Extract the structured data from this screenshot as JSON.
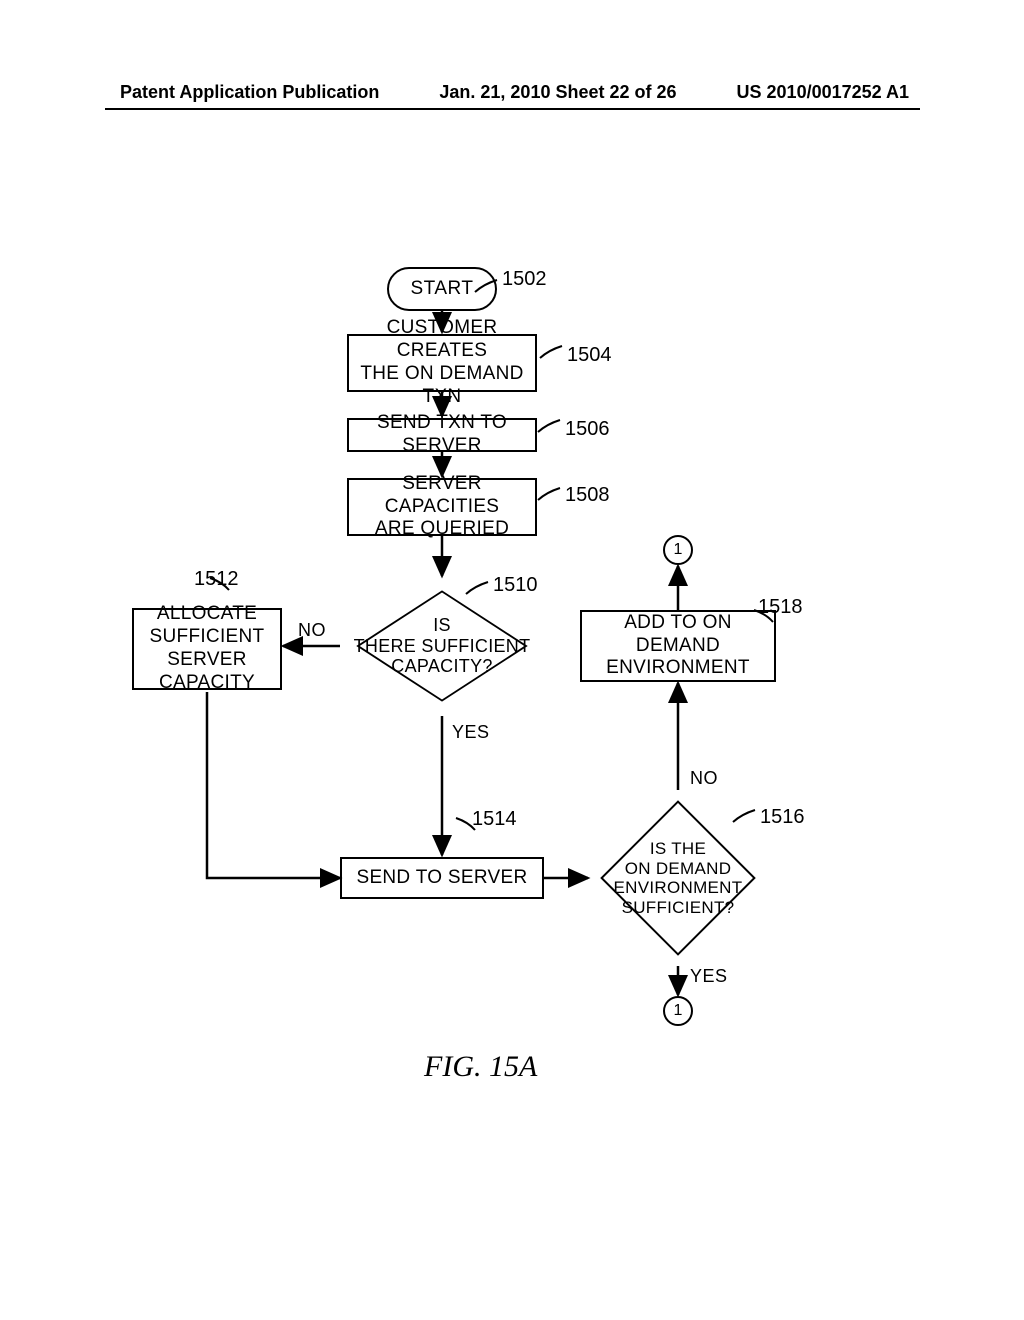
{
  "header": {
    "left": "Patent Application Publication",
    "center": "Jan. 21, 2010  Sheet 22 of 26",
    "right": "US 2010/0017252 A1"
  },
  "nodes": {
    "start": "START",
    "n1504": "CUSTOMER CREATES\nTHE ON DEMAND TXN",
    "n1506": "SEND TXN TO SERVER",
    "n1508": "SERVER CAPACITIES\nARE QUERIED",
    "n1510": "IS\nTHERE SUFFICIENT\nCAPACITY?",
    "n1512": "ALLOCATE\nSUFFICIENT\nSERVER CAPACITY",
    "n1514": "SEND TO SERVER",
    "n1516": "IS THE\nON DEMAND\nENVIRONMENT\nSUFFICIENT?",
    "n1518": "ADD TO ON DEMAND\nENVIRONMENT",
    "conn1": "1",
    "conn2": "1"
  },
  "refs": {
    "r1502": "1502",
    "r1504": "1504",
    "r1506": "1506",
    "r1508": "1508",
    "r1510": "1510",
    "r1512": "1512",
    "r1514": "1514",
    "r1516": "1516",
    "r1518": "1518"
  },
  "edges": {
    "no1": "NO",
    "yes1": "YES",
    "no2": "NO",
    "yes2": "YES"
  },
  "figure": "FIG. 15A"
}
